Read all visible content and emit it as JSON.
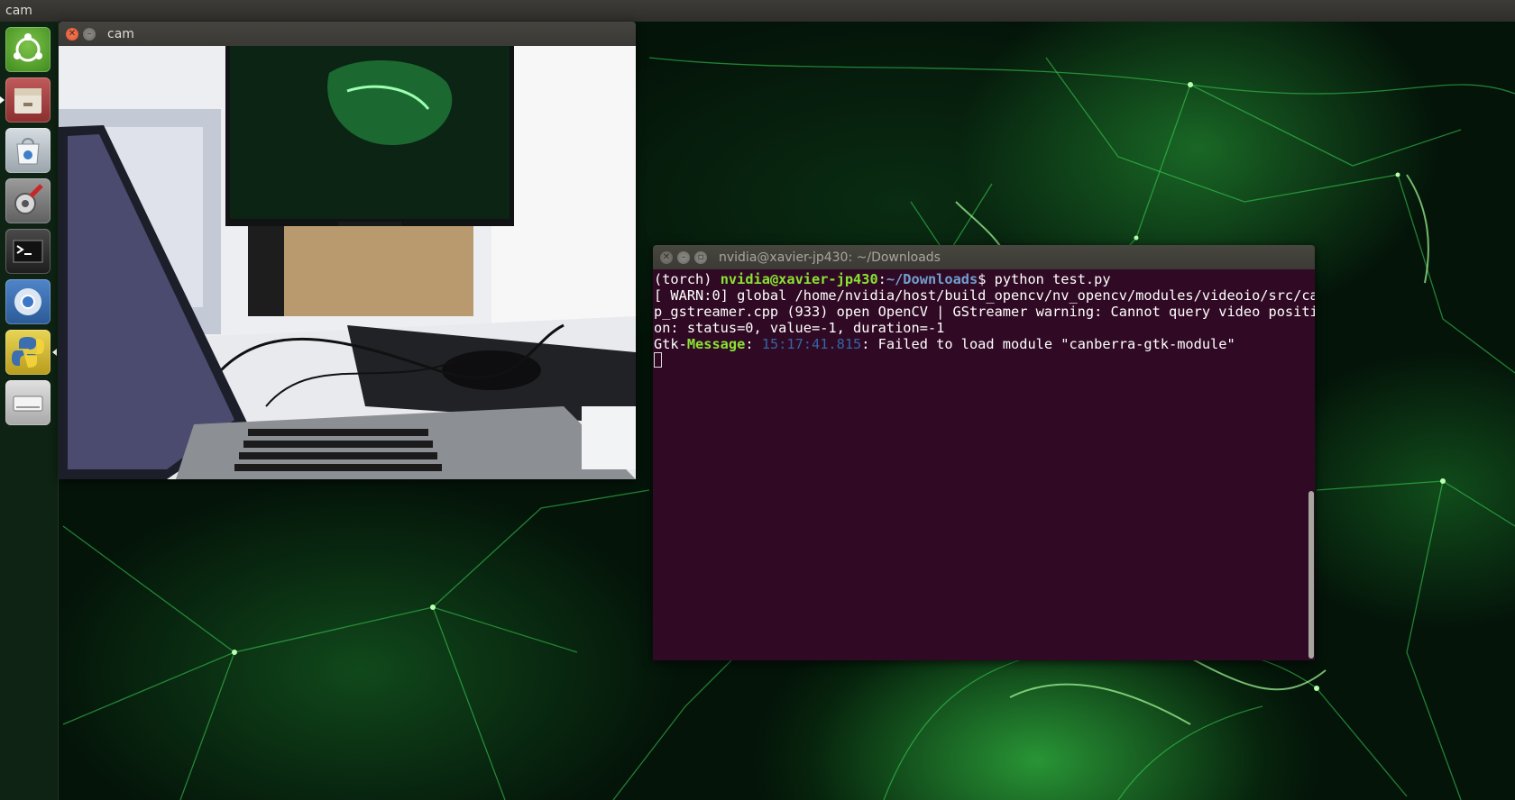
{
  "top_panel": {
    "title": "cam"
  },
  "launcher": {
    "items": [
      {
        "name": "ubuntu-dash-icon",
        "color": "#5aa02c"
      },
      {
        "name": "files-icon",
        "color": "#b54848"
      },
      {
        "name": "software-center-icon",
        "color": "#c0c7cc"
      },
      {
        "name": "system-settings-icon",
        "color": "#8a8a8a"
      },
      {
        "name": "terminal-icon",
        "color": "#2c2c2c"
      },
      {
        "name": "chromium-icon",
        "color": "#3b6fb3"
      },
      {
        "name": "python-icon",
        "color": "#d8c13a"
      },
      {
        "name": "drive-icon",
        "color": "#b9b9b9"
      }
    ]
  },
  "cam_window": {
    "title": "cam"
  },
  "terminal": {
    "title": "nvidia@xavier-jp430: ~/Downloads",
    "prompt_env": "(torch) ",
    "prompt_user": "nvidia@xavier-jp430",
    "prompt_sep": ":",
    "prompt_path": "~/Downloads",
    "prompt_dollar": "$ ",
    "command": "python test.py",
    "warn_lines": [
      "[ WARN:0] global /home/nvidia/host/build_opencv/nv_opencv/modules/videoio/src/ca",
      "p_gstreamer.cpp (933) open OpenCV | GStreamer warning: Cannot query video positi",
      "on: status=0, value=-1, duration=-1"
    ],
    "gtk_prefix": "Gtk-",
    "gtk_label": "Message",
    "gtk_colon": ": ",
    "gtk_time": "15:17:41.815",
    "gtk_msg": ": Failed to load module \"canberra-gtk-module\""
  },
  "colors": {
    "terminal_bg": "#300a24",
    "prompt_green": "#8ae234",
    "path_blue": "#729fcf"
  }
}
